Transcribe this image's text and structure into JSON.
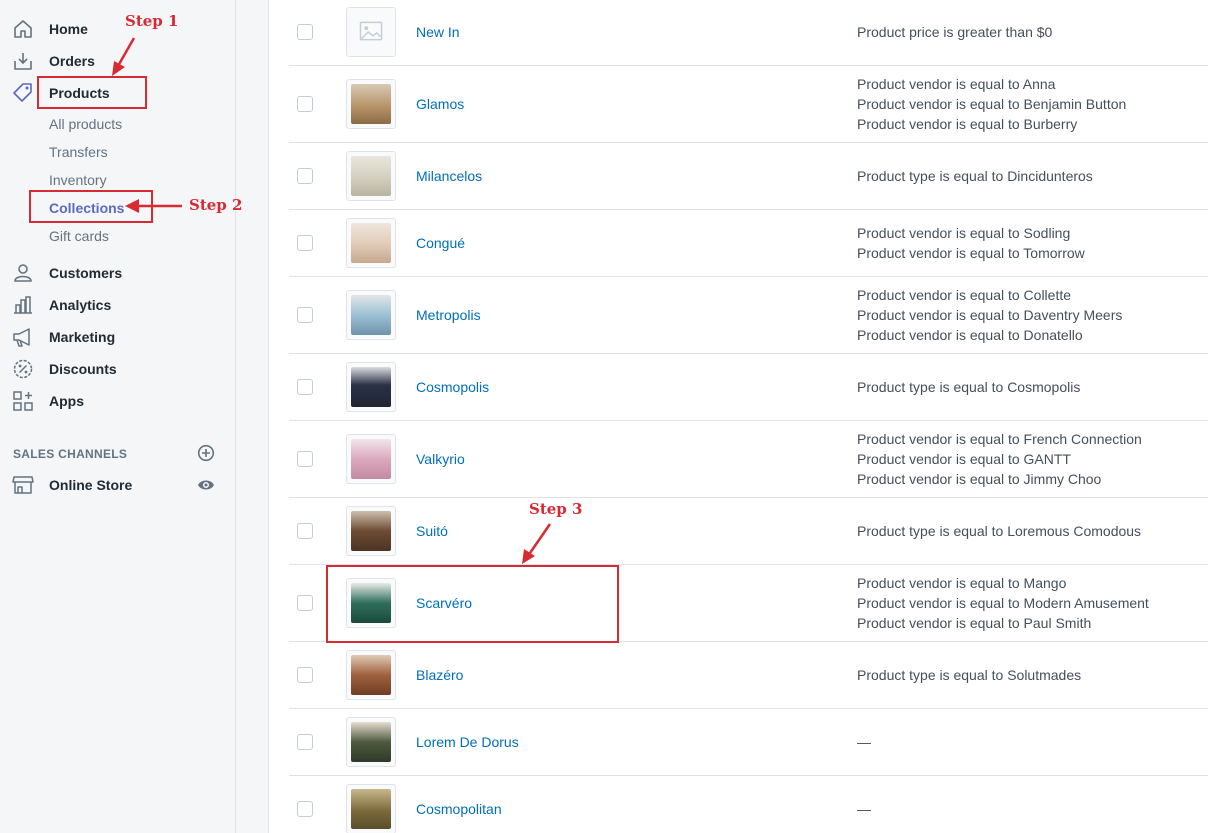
{
  "sidebar": {
    "nav": [
      {
        "label": "Home",
        "icon": "home-icon"
      },
      {
        "label": "Orders",
        "icon": "orders-icon"
      },
      {
        "label": "Products",
        "icon": "tag-icon"
      }
    ],
    "products_sub": [
      "All products",
      "Transfers",
      "Inventory",
      "Collections",
      "Gift cards"
    ],
    "nav2": [
      {
        "label": "Customers",
        "icon": "person-icon"
      },
      {
        "label": "Analytics",
        "icon": "bar-chart-icon"
      },
      {
        "label": "Marketing",
        "icon": "megaphone-icon"
      },
      {
        "label": "Discounts",
        "icon": "discount-icon"
      },
      {
        "label": "Apps",
        "icon": "apps-icon"
      }
    ],
    "sales_channels_header": "SALES CHANNELS",
    "online_store": "Online Store"
  },
  "annotations": {
    "step1": "Step 1",
    "step2": "Step 2",
    "step3": "Step 3",
    "color": "#d72a32"
  },
  "collections": [
    {
      "name": "New In",
      "conditions": [
        "Product price is greater than $0"
      ]
    },
    {
      "name": "Glamos",
      "conditions": [
        "Product vendor is equal to Anna",
        "Product vendor is equal to Benjamin Button",
        "Product vendor is equal to Burberry"
      ]
    },
    {
      "name": "Milancelos",
      "conditions": [
        "Product type is equal to Dincidunteros"
      ]
    },
    {
      "name": "Congué",
      "conditions": [
        "Product vendor is equal to Sodling",
        "Product vendor is equal to Tomorrow"
      ]
    },
    {
      "name": "Metropolis",
      "conditions": [
        "Product vendor is equal to Collette",
        "Product vendor is equal to Daventry Meers",
        "Product vendor is equal to Donatello"
      ]
    },
    {
      "name": "Cosmopolis",
      "conditions": [
        "Product type is equal to Cosmopolis"
      ]
    },
    {
      "name": "Valkyrio",
      "conditions": [
        "Product vendor is equal to French Connection",
        "Product vendor is equal to GANTT",
        "Product vendor is equal to Jimmy Choo"
      ]
    },
    {
      "name": "Suitó",
      "conditions": [
        "Product type is equal to Loremous Comodous"
      ]
    },
    {
      "name": "Scarvéro",
      "conditions": [
        "Product vendor is equal to Mango",
        "Product vendor is equal to Modern Amusement",
        "Product vendor is equal to Paul Smith"
      ]
    },
    {
      "name": "Blazéro",
      "conditions": [
        "Product type is equal to Solutmades"
      ]
    },
    {
      "name": "Lorem De Dorus",
      "conditions": [
        "—"
      ]
    },
    {
      "name": "Cosmopolitan",
      "conditions": [
        "—"
      ]
    }
  ],
  "colors": {
    "link": "#006fbb",
    "active_nav": "#5c6ac4",
    "annotation": "#d72a32"
  }
}
